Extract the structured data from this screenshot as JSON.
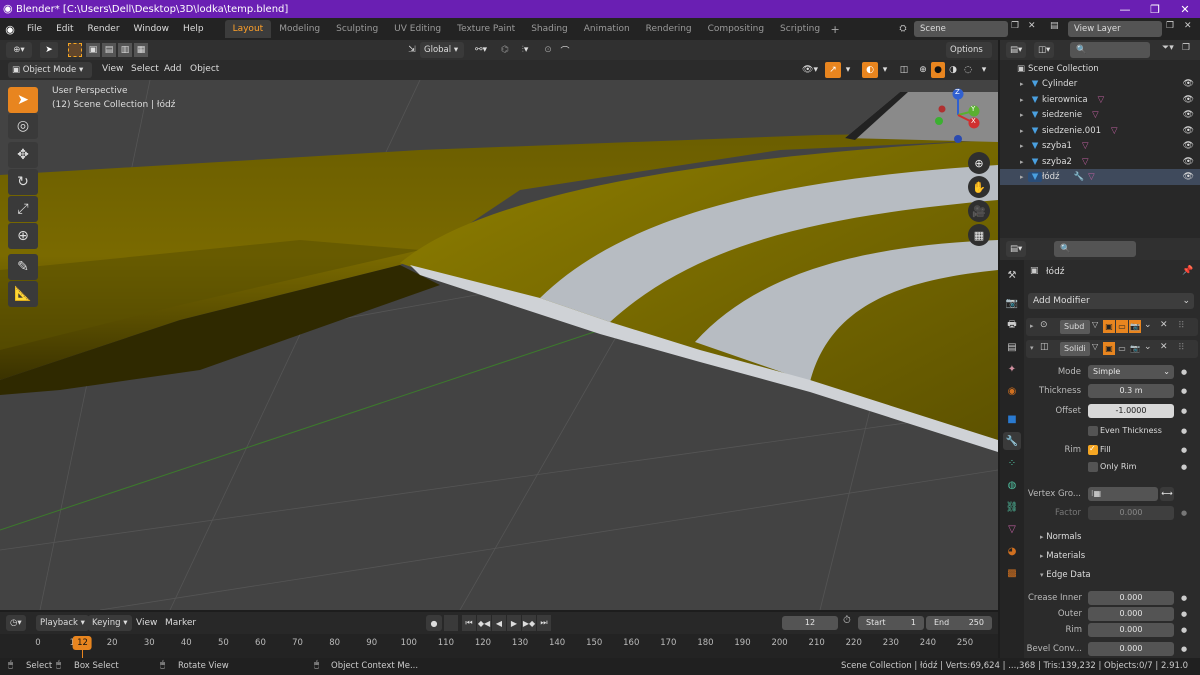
{
  "titlebar": {
    "title": "Blender* [C:\\Users\\Dell\\Desktop\\3D\\lodka\\temp.blend]"
  },
  "menu": [
    "File",
    "Edit",
    "Render",
    "Window",
    "Help"
  ],
  "workspaces": [
    "Layout",
    "Modeling",
    "Sculpting",
    "UV Editing",
    "Texture Paint",
    "Shading",
    "Animation",
    "Rendering",
    "Compositing",
    "Scripting"
  ],
  "scene": {
    "name": "Scene",
    "view_layer": "View Layer"
  },
  "header": {
    "transform_orientation": "Global",
    "options": "Options",
    "mode": "Object Mode",
    "menus": [
      "View",
      "Select",
      "Add",
      "Object"
    ]
  },
  "viewport": {
    "perspective": "User Perspective",
    "collection_info": "(12) Scene Collection | łódź",
    "gizmo": {
      "z": "Z",
      "y": "Y",
      "x": "X"
    }
  },
  "outliner": {
    "root": "Scene Collection",
    "items": [
      {
        "name": "Cylinder"
      },
      {
        "name": "kierownica"
      },
      {
        "name": "siedzenie"
      },
      {
        "name": "siedzenie.001"
      },
      {
        "name": "szyba1"
      },
      {
        "name": "szyba2"
      },
      {
        "name": "łódź"
      }
    ]
  },
  "properties": {
    "object_name": "łódź",
    "add_modifier": "Add Modifier",
    "modifiers": [
      {
        "short": "Subd"
      },
      {
        "short": "Solidi"
      }
    ],
    "mode_label": "Mode",
    "mode_value": "Simple",
    "thickness_label": "Thickness",
    "thickness_value": "0.3 m",
    "offset_label": "Offset",
    "offset_value": "-1.0000",
    "even_thickness": "Even Thickness",
    "rim_label": "Rim",
    "fill": "Fill",
    "only_rim": "Only Rim",
    "vertex_group_label": "Vertex Gro...",
    "factor_label": "Factor",
    "factor_value": "0.000",
    "sections": [
      "Normals",
      "Materials",
      "Edge Data"
    ],
    "crease_inner_label": "Crease Inner",
    "crease_inner_value": "0.000",
    "outer_label": "Outer",
    "outer_value": "0.000",
    "rim_crease_label": "Rim",
    "rim_crease_value": "0.000",
    "bevel_label": "Bevel Conv...",
    "bevel_value": "0.000"
  },
  "timeline": {
    "menus": [
      "Playback",
      "Keying",
      "View",
      "Marker"
    ],
    "current_frame": "12",
    "start_label": "Start",
    "start": "1",
    "end_label": "End",
    "end": "250",
    "ticks": [
      "0",
      "10",
      "20",
      "30",
      "40",
      "50",
      "60",
      "70",
      "80",
      "90",
      "100",
      "110",
      "120",
      "130",
      "140",
      "150",
      "160",
      "170",
      "180",
      "190",
      "200",
      "210",
      "220",
      "230",
      "240",
      "250"
    ],
    "playhead": 12
  },
  "statusbar": {
    "select": "Select",
    "box_select": "Box Select",
    "rotate": "Rotate View",
    "context": "Object Context Me...",
    "stats": "Scene Collection | łódź | Verts:69,624 | ...,368 | Tris:139,232 | Objects:0/7 | 2.91.0"
  },
  "colors": {
    "accent": "#e8851f",
    "title_bg": "#6a1fb3",
    "hull_yellow": "#8a7a00",
    "stripe": "#b7bcc2"
  }
}
